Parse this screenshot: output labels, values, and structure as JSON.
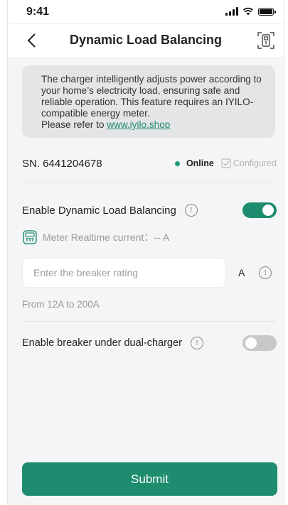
{
  "status_bar": {
    "time": "9:41",
    "icons": [
      "signal-icon",
      "wifi-icon",
      "battery-icon"
    ]
  },
  "nav": {
    "title": "Dynamic Load Balancing",
    "back_icon": "chevron-left-icon",
    "action_icon": "device-scan-icon"
  },
  "info": {
    "text": "The charger intelligently adjusts power according to your home’s electricity load, ensuring safe and reliable operation. This feature requires an IYILO-compatible energy meter.",
    "refer_text": "Please refer to ",
    "link_text": "www.iyilo.shop"
  },
  "device": {
    "sn": "SN. 6441204678",
    "status": "Online",
    "configured": "Configured"
  },
  "dlb": {
    "label": "Enable Dynamic Load Balancing",
    "enabled": true,
    "meter_label": "Meter Realtime current：-- A"
  },
  "breaker": {
    "placeholder": "Enter the breaker rating",
    "value": "",
    "unit": "A",
    "range": "From 12A  to  200A"
  },
  "dual_charger": {
    "label": "Enable breaker under dual-charger",
    "enabled": false
  },
  "submit_label": "Submit",
  "colors": {
    "accent": "#1e8c6e",
    "background": "#f4f5f6",
    "info_box": "#e4e5e7"
  }
}
